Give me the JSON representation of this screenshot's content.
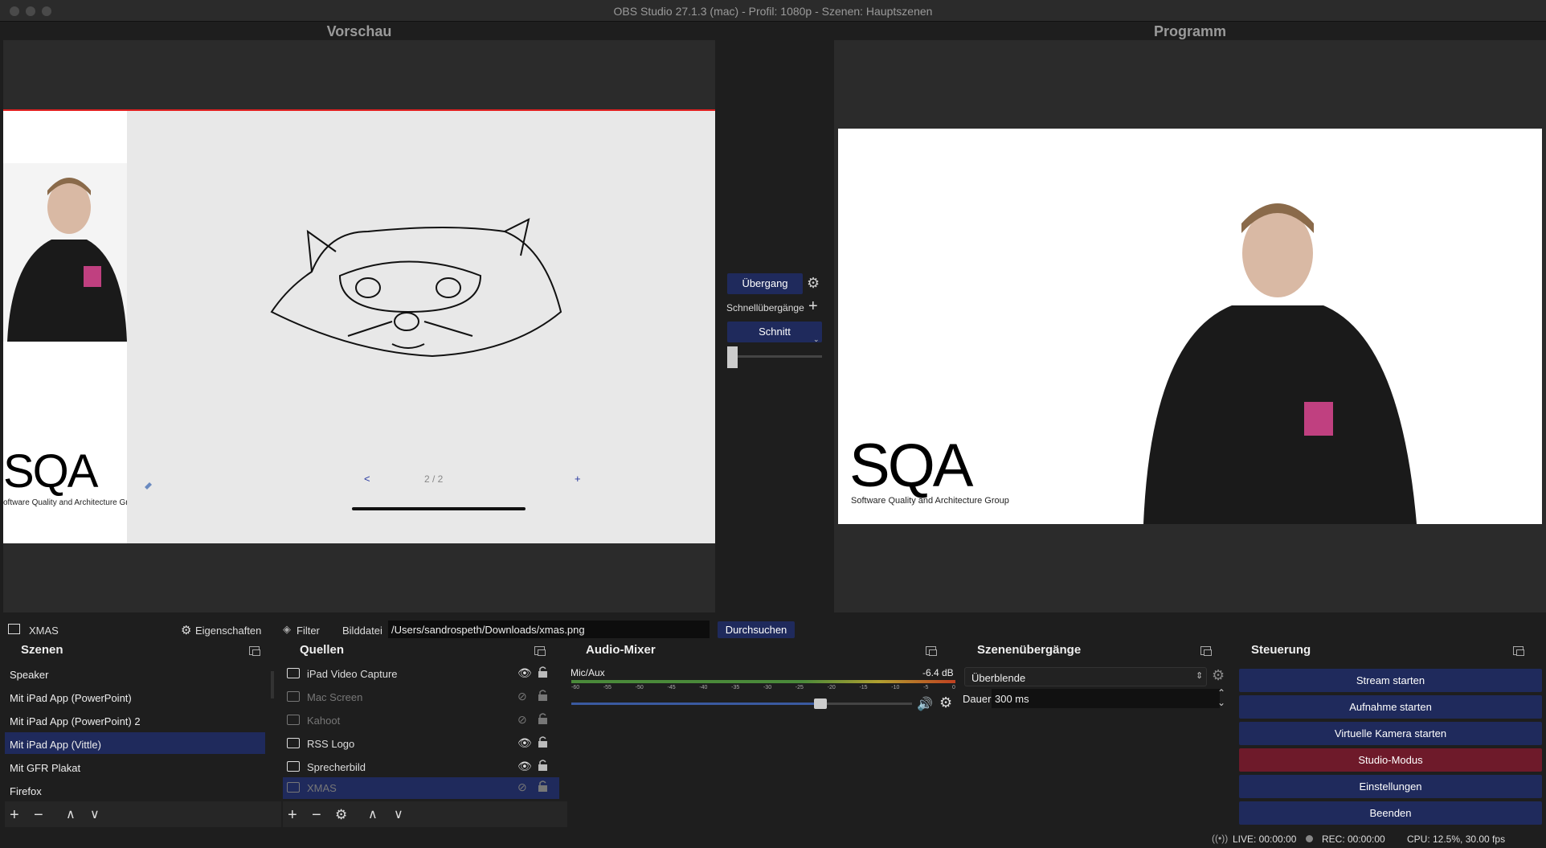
{
  "window": {
    "title": "OBS Studio 27.1.3 (mac) - Profil: 1080p - Szenen: Hauptszenen"
  },
  "preview": {
    "label": "Vorschau",
    "page_indicator": "2 / 2",
    "prev": "<",
    "next": "+",
    "logo_text": "SQA",
    "logo_sub": "oftware Quality and Architecture Group"
  },
  "program": {
    "label": "Programm",
    "logo_text": "SQA",
    "logo_sub": "Software Quality and Architecture Group"
  },
  "transition": {
    "button": "Übergang",
    "quick": "Schnellübergänge",
    "cut": "Schnitt"
  },
  "source_toolbar": {
    "source_name": "XMAS",
    "properties": "Eigenschaften",
    "filter": "Filter",
    "file_label": "Bilddatei",
    "file_path": "/Users/sandrospeth/Downloads/xmas.png",
    "browse": "Durchsuchen"
  },
  "scenes": {
    "title": "Szenen",
    "items": [
      "Speaker",
      "Mit iPad App (PowerPoint)",
      "Mit iPad App (PowerPoint) 2",
      "Mit iPad App (Vittle)",
      "Mit GFR Plakat",
      "Firefox"
    ],
    "selected_index": 3
  },
  "sources": {
    "title": "Quellen",
    "items": [
      {
        "name": "iPad Video Capture",
        "visible": true
      },
      {
        "name": "Mac Screen",
        "visible": false
      },
      {
        "name": "Kahoot",
        "visible": false
      },
      {
        "name": "RSS Logo",
        "visible": true
      },
      {
        "name": "Sprecherbild",
        "visible": true
      },
      {
        "name": "XMAS",
        "visible": false
      }
    ]
  },
  "mixer": {
    "title": "Audio-Mixer",
    "channel": "Mic/Aux",
    "level": "-6.4 dB",
    "ticks": [
      "-60",
      "-55",
      "-50",
      "-45",
      "-40",
      "-35",
      "-30",
      "-25",
      "-20",
      "-15",
      "-10",
      "-5",
      "0"
    ],
    "volume_fraction": 0.73
  },
  "transitions_panel": {
    "title": "Szenenübergänge",
    "selected": "Überblende",
    "duration_label": "Dauer",
    "duration": "300 ms"
  },
  "controls": {
    "title": "Steuerung",
    "buttons": [
      "Stream starten",
      "Aufnahme starten",
      "Virtuelle Kamera starten",
      "Studio-Modus",
      "Einstellungen",
      "Beenden"
    ],
    "active_index": 3
  },
  "status": {
    "live": "LIVE: 00:00:00",
    "rec": "REC: 00:00:00",
    "cpu": "CPU: 12.5%, 30.00 fps"
  },
  "colors": {
    "accent": "#1f2a5c",
    "active": "#6e1a2a",
    "selection": "#1f2a5c"
  }
}
